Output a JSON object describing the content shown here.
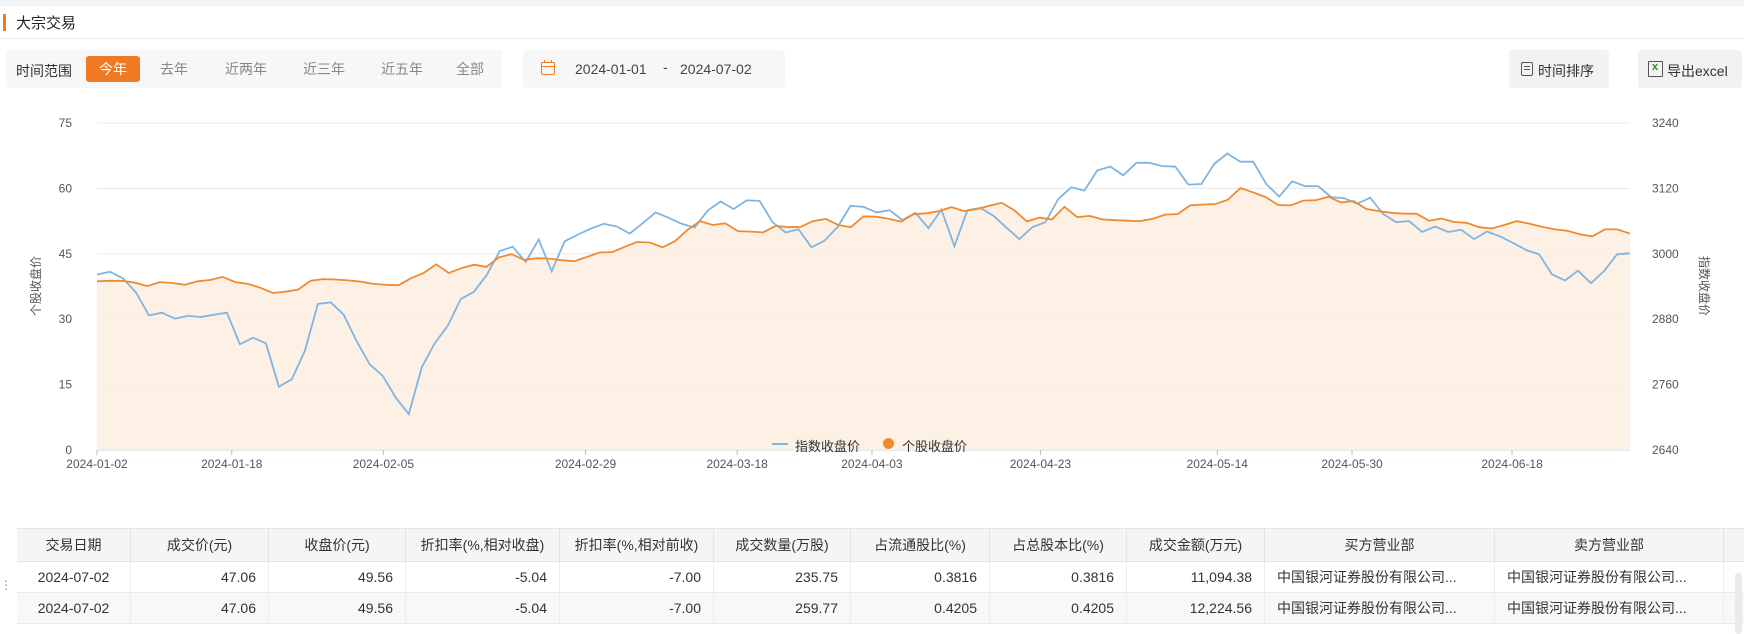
{
  "header": {
    "title": "大宗交易"
  },
  "filters": {
    "range_label": "时间范围",
    "ranges": [
      "今年",
      "去年",
      "近两年",
      "近三年",
      "近五年",
      "全部"
    ],
    "active_range": "今年",
    "date_from": "2024-01-01",
    "date_sep": "-",
    "date_to": "2024-07-02"
  },
  "toolbar": {
    "sort_label": "时间排序",
    "export_label": "导出excel"
  },
  "colors": {
    "accent": "#f07a24",
    "index_line": "#7fb5e0",
    "stock_line": "#f08a30",
    "area_fill": "#fdeee2"
  },
  "chart_data": {
    "type": "line",
    "x_ticks": [
      "2024-01-02",
      "2024-01-18",
      "2024-02-05",
      "2024-02-29",
      "2024-03-18",
      "2024-04-03",
      "2024-04-23",
      "2024-05-14",
      "2024-05-30",
      "2024-06-18"
    ],
    "x_start": "2024-01-02",
    "x_end": "2024-07-02",
    "ylabel_left": "个股收盘价",
    "ylabel_right": "指数收盘价",
    "ylim_left": [
      0,
      75
    ],
    "yticks_left": [
      0,
      15,
      30,
      45,
      60,
      75
    ],
    "ylim_right": [
      2640,
      3240
    ],
    "yticks_right": [
      2640,
      2760,
      2880,
      3000,
      3120,
      3240
    ],
    "grid": true,
    "legend_position": "bottom-center",
    "series": [
      {
        "name": "指数收盘价",
        "axis": "right",
        "values": [
          2962,
          2967,
          2955,
          2929,
          2887,
          2892,
          2881,
          2886,
          2884,
          2888,
          2892,
          2834,
          2846,
          2836,
          2756,
          2770,
          2822,
          2908,
          2911,
          2888,
          2839,
          2797,
          2776,
          2736,
          2706,
          2792,
          2836,
          2868,
          2917,
          2930,
          2961,
          3005,
          3013,
          2985,
          3026,
          2968,
          3023,
          3035,
          3046,
          3055,
          3050,
          3037,
          3056,
          3076,
          3066,
          3055,
          3048,
          3079,
          3096,
          3082,
          3098,
          3097,
          3058,
          3039,
          3045,
          3012,
          3024,
          3049,
          3088,
          3086,
          3076,
          3080,
          3062,
          3075,
          3047,
          3081,
          3014,
          3080,
          3084,
          3070,
          3048,
          3027,
          3049,
          3058,
          3101,
          3122,
          3116,
          3153,
          3160,
          3144,
          3167,
          3167,
          3161,
          3160,
          3127,
          3128,
          3165,
          3184,
          3169,
          3169,
          3128,
          3105,
          3133,
          3124,
          3124,
          3104,
          3102,
          3092,
          3103,
          3073,
          3058,
          3060,
          3040,
          3050,
          3040,
          3044,
          3027,
          3041,
          3032,
          3020,
          3007,
          2999,
          2962,
          2951,
          2969,
          2946,
          2968,
          2999,
          3001
        ]
      },
      {
        "name": "个股收盘价",
        "axis": "left",
        "values": [
          38.7,
          38.8,
          38.8,
          38.4,
          37.6,
          38.5,
          38.3,
          37.9,
          38.7,
          39.0,
          39.7,
          38.5,
          38.1,
          37.2,
          36.0,
          36.3,
          36.8,
          38.8,
          39.2,
          39.1,
          38.9,
          38.6,
          38.1,
          37.9,
          37.8,
          39.4,
          40.6,
          42.6,
          40.6,
          41.7,
          42.5,
          42.0,
          44.2,
          44.9,
          43.6,
          44.0,
          43.9,
          43.5,
          43.3,
          44.3,
          45.3,
          45.4,
          46.6,
          47.7,
          47.6,
          46.5,
          47.9,
          50.5,
          52.5,
          51.6,
          52.0,
          50.2,
          50.1,
          49.9,
          51.4,
          51.1,
          51.2,
          52.5,
          53.0,
          51.6,
          51.1,
          53.6,
          53.5,
          53.0,
          52.4,
          54.1,
          54.3,
          54.8,
          55.7,
          54.8,
          55.2,
          56.0,
          56.7,
          55.0,
          52.4,
          53.3,
          52.9,
          55.8,
          53.4,
          53.7,
          52.9,
          52.7,
          52.6,
          52.5,
          53.0,
          54.0,
          54.1,
          56.1,
          56.3,
          56.4,
          57.4,
          60.1,
          59.1,
          58.0,
          56.2,
          56.1,
          57.2,
          57.3,
          58.1,
          56.8,
          57.1,
          55.3,
          54.8,
          54.4,
          54.2,
          54.2,
          52.6,
          53.1,
          52.3,
          52.1,
          51.1,
          50.8,
          51.6,
          52.5,
          51.9,
          51.2,
          50.6,
          50.3,
          49.5,
          49.0,
          50.6,
          50.6,
          49.6
        ]
      }
    ]
  },
  "table": {
    "columns": [
      "交易日期",
      "成交价(元)",
      "收盘价(元)",
      "折扣率(%,相对收盘)",
      "折扣率(%,相对前收)",
      "成交数量(万股)",
      "占流通股比(%)",
      "占总股本比(%)",
      "成交金额(万元)",
      "买方营业部",
      "卖方营业部"
    ],
    "rows": [
      [
        "2024-07-02",
        "47.06",
        "49.56",
        "-5.04",
        "-7.00",
        "235.75",
        "0.3816",
        "0.3816",
        "11,094.38",
        "中国银河证券股份有限公司...",
        "中国银河证券股份有限公司..."
      ],
      [
        "2024-07-02",
        "47.06",
        "49.56",
        "-5.04",
        "-7.00",
        "259.77",
        "0.4205",
        "0.4205",
        "12,224.56",
        "中国银河证券股份有限公司...",
        "中国银河证券股份有限公司..."
      ]
    ]
  }
}
